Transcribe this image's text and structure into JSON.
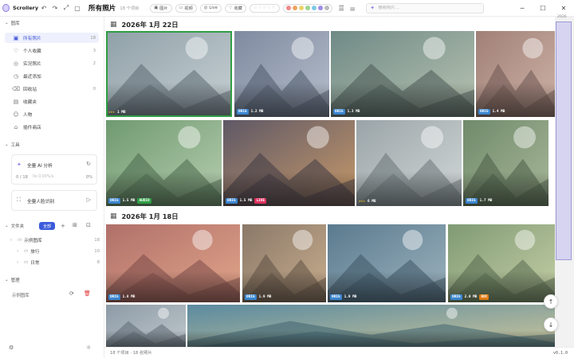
{
  "app": {
    "name": "Scrollery",
    "title": "所有照片",
    "item_count": "18 个项目"
  },
  "toolbar": {
    "chips": [
      "图片",
      "视频",
      "Live",
      "收藏"
    ],
    "palette": [
      "#ee8a8a",
      "#f0a35e",
      "#ead36a",
      "#9bd48e",
      "#7ec9e8",
      "#a08be6",
      "#bcbcbc"
    ],
    "search_placeholder": "搜索照片..."
  },
  "sidebar": {
    "library_label": "图库",
    "items": [
      {
        "label": "所有照片",
        "count": "18",
        "icon": "image-icon"
      },
      {
        "label": "个人收藏",
        "count": "3",
        "icon": "heart-icon"
      },
      {
        "label": "实况照片",
        "count": "2",
        "icon": "live-icon"
      },
      {
        "label": "最近添加",
        "count": "",
        "icon": "clock-icon"
      },
      {
        "label": "回收站",
        "count": "0",
        "icon": "trash-icon"
      },
      {
        "label": "收藏夹",
        "count": "",
        "icon": "bookmark-icon"
      },
      {
        "label": "人物",
        "count": "",
        "icon": "person-icon"
      },
      {
        "label": "插件商店",
        "count": "",
        "icon": "store-icon"
      }
    ],
    "tools_label": "工具",
    "ai_title": "全量 AI 分析",
    "ai_progress_text": "0 / 18",
    "ai_progress_sub": "0s  0.00%/s",
    "ai_percent": "0%",
    "face_title": "全量人脸识别",
    "folders_label": "文件夹",
    "all_button": "全部",
    "folders": [
      {
        "name": "示例图库",
        "count": "18"
      },
      {
        "name": "旅行",
        "count": "10"
      },
      {
        "name": "日常",
        "count": "8"
      }
    ],
    "manage_label": "管理",
    "manage_item": "示例图库"
  },
  "groups": [
    {
      "date": "2026年 1月 22日"
    },
    {
      "date": "2026年 1月 18日"
    }
  ],
  "photos": [
    {
      "badges": [
        {
          "t": "stars",
          "v": "★★★"
        },
        {
          "t": "size",
          "v": "1 MB"
        }
      ]
    },
    {
      "badges": [
        {
          "t": "orig",
          "v": "ORIG"
        },
        {
          "t": "size",
          "v": "1.2 MB"
        }
      ]
    },
    {
      "badges": [
        {
          "t": "orig",
          "v": "ORIG"
        },
        {
          "t": "size",
          "v": "1.3 MB"
        }
      ]
    },
    {
      "badges": [
        {
          "t": "orig",
          "v": "ORIG"
        },
        {
          "t": "size",
          "v": "1.4 MB"
        }
      ]
    },
    {
      "badges": [
        {
          "t": "orig",
          "v": "ORIG"
        },
        {
          "t": "size",
          "v": "1.5 MB"
        },
        {
          "t": "audio",
          "v": "AUDIO"
        }
      ]
    },
    {
      "badges": [
        {
          "t": "orig",
          "v": "ORIG"
        },
        {
          "t": "size",
          "v": "1.5 MB"
        },
        {
          "t": "live",
          "v": "LIVE"
        }
      ]
    },
    {
      "badges": [
        {
          "t": "stars",
          "v": "★★★"
        },
        {
          "t": "size",
          "v": "6 MB"
        }
      ]
    },
    {
      "badges": [
        {
          "t": "orig",
          "v": "ORIG"
        },
        {
          "t": "size",
          "v": "1.7 MB"
        }
      ]
    },
    {
      "badges": [
        {
          "t": "orig",
          "v": "ORIG"
        },
        {
          "t": "size",
          "v": "1.8 MB"
        }
      ]
    },
    {
      "badges": [
        {
          "t": "orig",
          "v": "ORIG"
        },
        {
          "t": "size",
          "v": "1.9 MB"
        }
      ]
    },
    {
      "badges": [
        {
          "t": "orig",
          "v": "ORIG"
        },
        {
          "t": "size",
          "v": "1.9 MB"
        }
      ]
    },
    {
      "badges": [
        {
          "t": "orig",
          "v": "ORIG"
        },
        {
          "t": "size",
          "v": "2.0 MB"
        },
        {
          "t": "doc",
          "v": "DOC"
        }
      ]
    },
    {
      "badges": []
    },
    {
      "badges": []
    }
  ],
  "scroll_label": "2026",
  "status": {
    "text": "18 个项目 · 18 张照片",
    "version": "v0.1.0"
  }
}
